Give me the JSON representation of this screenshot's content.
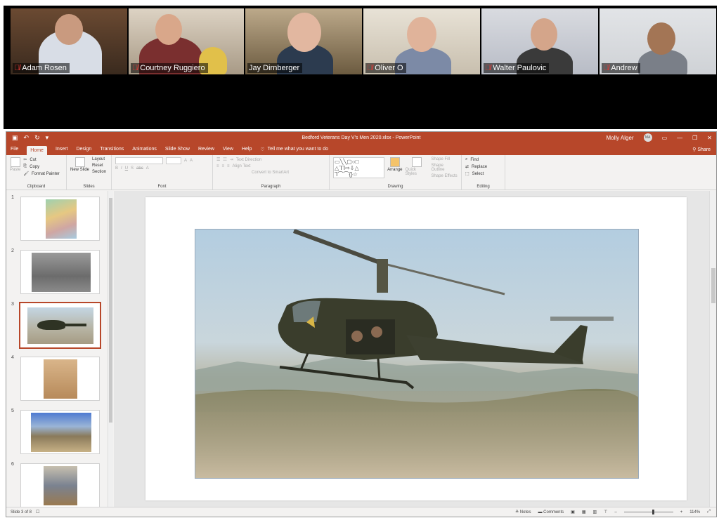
{
  "zoom": {
    "participants": [
      {
        "name": "Adam Rosen"
      },
      {
        "name": "Courtney Ruggiero"
      },
      {
        "name": "Jay Dirnberger"
      },
      {
        "name": "Oliver O"
      },
      {
        "name": "Walter Paulovic"
      },
      {
        "name": "Andrew"
      }
    ]
  },
  "ppt": {
    "doc_title": "Bedford Veterans Day V's Men 2020.xlsx - PowerPoint",
    "user_name": "Molly Alger",
    "user_initials": "MA",
    "tabs": [
      "File",
      "Home",
      "Insert",
      "Design",
      "Transitions",
      "Animations",
      "Slide Show",
      "Review",
      "View",
      "Help"
    ],
    "active_tab": "Home",
    "tell_me": "Tell me what you want to do",
    "share": "Share",
    "ribbon": {
      "clipboard": {
        "label": "Clipboard",
        "paste": "Paste",
        "cut": "Cut",
        "copy": "Copy",
        "format_painter": "Format Painter"
      },
      "slides": {
        "label": "Slides",
        "new_slide": "New Slide",
        "layout": "Layout",
        "reset": "Reset",
        "section": "Section"
      },
      "font": {
        "label": "Font"
      },
      "paragraph": {
        "label": "Paragraph",
        "text_direction": "Text Direction",
        "align_text": "Align Text",
        "convert_smartart": "Convert to SmartArt"
      },
      "drawing": {
        "label": "Drawing",
        "arrange": "Arrange",
        "quick_styles": "Quick Styles",
        "shape_fill": "Shape Fill",
        "shape_outline": "Shape Outline",
        "shape_effects": "Shape Effects"
      },
      "editing": {
        "label": "Editing",
        "find": "Find",
        "replace": "Replace",
        "select": "Select"
      }
    },
    "thumbnails": [
      "1",
      "2",
      "3",
      "4",
      "5",
      "6"
    ],
    "selected_slide": 3,
    "status": {
      "slide_info": "Slide 3 of 8",
      "notes": "Notes",
      "comments": "Comments",
      "zoom": "114%"
    }
  }
}
